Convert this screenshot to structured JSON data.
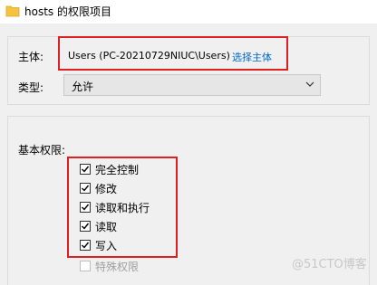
{
  "window": {
    "title": "hosts 的权限项目",
    "folder_icon": "folder-icon"
  },
  "principal": {
    "label": "主体:",
    "value": "Users (PC-20210729NIUC\\Users)",
    "link": "选择主体"
  },
  "type": {
    "label": "类型:",
    "value": "允许"
  },
  "basic_permissions": {
    "label": "基本权限:",
    "items": [
      {
        "label": "完全控制",
        "checked": true
      },
      {
        "label": "修改",
        "checked": true
      },
      {
        "label": "读取和执行",
        "checked": true
      },
      {
        "label": "读取",
        "checked": true
      },
      {
        "label": "写入",
        "checked": true
      },
      {
        "label": "特殊权限",
        "checked": false,
        "disabled": true
      }
    ]
  },
  "watermark": "@51CTO博客",
  "colors": {
    "highlight": "#e02020",
    "link": "#0066cc",
    "folder": "#f5c342"
  }
}
